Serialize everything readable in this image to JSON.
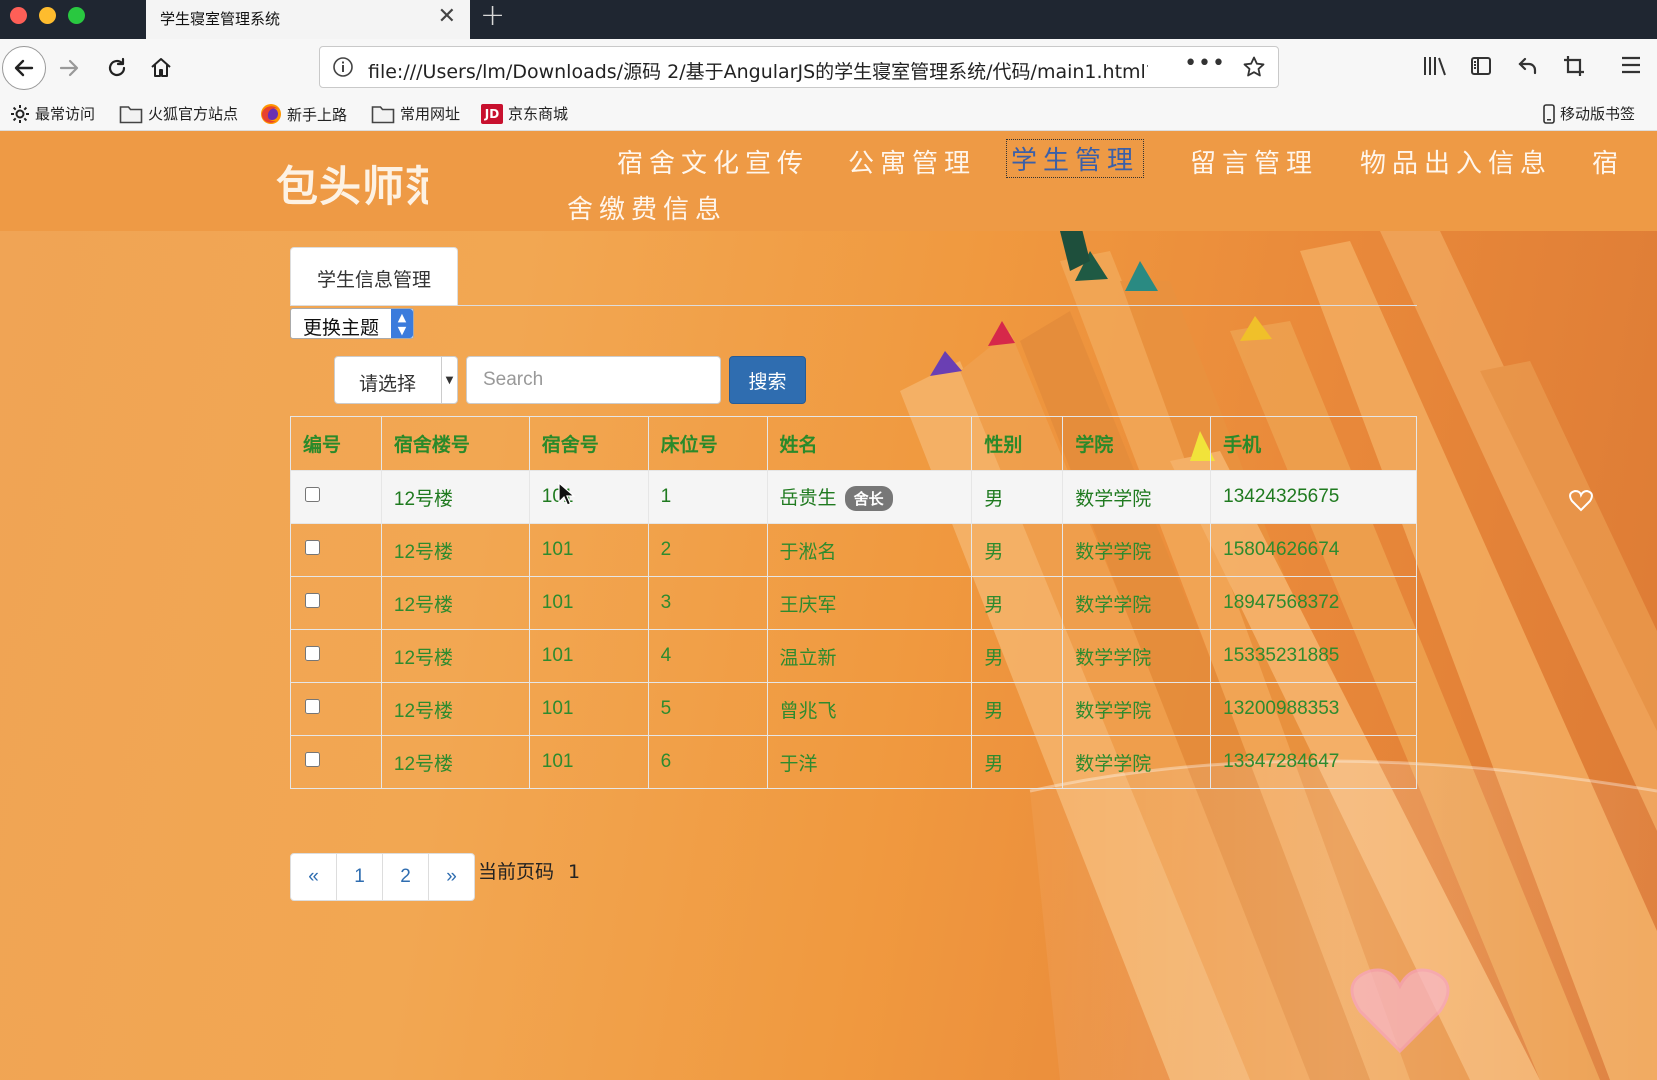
{
  "browser": {
    "tab_title": "学生寝室管理系统",
    "url": "file:///Users/lm/Downloads/源码 2/基于AngularJS的学生寝室管理系统/代码/main1.html?",
    "bookmarks": [
      {
        "label": "最常访问",
        "icon": "gear-icon"
      },
      {
        "label": "火狐官方站点",
        "icon": "folder-icon"
      },
      {
        "label": "新手上路",
        "icon": "firefox-icon"
      },
      {
        "label": "常用网址",
        "icon": "folder-icon"
      },
      {
        "label": "京东商城",
        "icon": "jd-icon"
      }
    ],
    "mobile_bookmarks": "移动版书签",
    "jd_logo": "JD"
  },
  "site": {
    "logo": "包头师范",
    "menu": [
      "宿舍文化宣传",
      "公寓管理",
      "学生管理",
      "留言管理",
      "物品出入信息",
      "宿",
      "舍缴费信息"
    ],
    "active_menu": "学生管理"
  },
  "panel": {
    "tab_label": "学生信息管理",
    "theme_select": "更换主题",
    "filter_label": "请选择",
    "search_placeholder": "Search",
    "search_button": "搜索"
  },
  "table": {
    "headers": [
      "编号",
      "宿舍楼号",
      "宿舍号",
      "床位号",
      "姓名",
      "性别",
      "学院",
      "手机"
    ],
    "rows": [
      {
        "building": "12号楼",
        "room": "101",
        "bed": "1",
        "name": "岳贵生",
        "badge": "舍长",
        "gender": "男",
        "college": "数学学院",
        "phone": "13424325675"
      },
      {
        "building": "12号楼",
        "room": "101",
        "bed": "2",
        "name": "于淞名",
        "badge": "",
        "gender": "男",
        "college": "数学学院",
        "phone": "15804626674"
      },
      {
        "building": "12号楼",
        "room": "101",
        "bed": "3",
        "name": "王庆军",
        "badge": "",
        "gender": "男",
        "college": "数学学院",
        "phone": "18947568372"
      },
      {
        "building": "12号楼",
        "room": "101",
        "bed": "4",
        "name": "温立新",
        "badge": "",
        "gender": "男",
        "college": "数学学院",
        "phone": "15335231885"
      },
      {
        "building": "12号楼",
        "room": "101",
        "bed": "5",
        "name": "曾兆飞",
        "badge": "",
        "gender": "男",
        "college": "数学学院",
        "phone": "13200988353"
      },
      {
        "building": "12号楼",
        "room": "101",
        "bed": "6",
        "name": "于洋",
        "badge": "",
        "gender": "男",
        "college": "数学学院",
        "phone": "13347284647"
      }
    ]
  },
  "pagination": {
    "prev": "«",
    "pages": [
      "1",
      "2"
    ],
    "next": "»",
    "current_label": "当前页码",
    "current_page": "1"
  },
  "colors": {
    "header_orange": "#ee9a45",
    "table_text_green": "#2e8b2e",
    "search_button_blue": "#2f6db0"
  }
}
